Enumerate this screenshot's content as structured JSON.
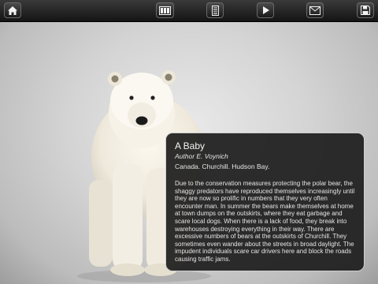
{
  "toolbar": {
    "home_icon": "home-icon",
    "filmstrip_icon": "filmstrip-icon",
    "thumbnails_icon": "thumbnails-icon",
    "play_icon": "play-icon",
    "mail_icon": "mail-icon",
    "save_icon": "save-icon"
  },
  "photo": {
    "subject": "polar-bear-photo"
  },
  "card": {
    "title": "A Baby",
    "author": "Author E. Voynich",
    "location": "Canada. Churchill. Hudson Bay.",
    "body": "Due to the conservation measures protecting the polar bear, the shaggy predators have reproduced themselves increasingly until they are now so prolific in numbers that they very often encounter man. In summer the bears make themselves at home at town dumps on the outskirts, where they eat garbage and scare local dogs. When there is a lack of food, they break into warehouses destroying everything in their way. There are excessive numbers of bears at the outskirts of Churchill. They sometimes even wander about the streets in broad daylight. The impudent individuals scare car drivers here and block the roads causing traffic jams."
  },
  "colors": {
    "toolbar_top": "#3a3a3a",
    "toolbar_bottom": "#141414",
    "card_background": "#1c1c1c",
    "card_border": "#cfcfcf",
    "card_text": "#e6e6e6"
  }
}
